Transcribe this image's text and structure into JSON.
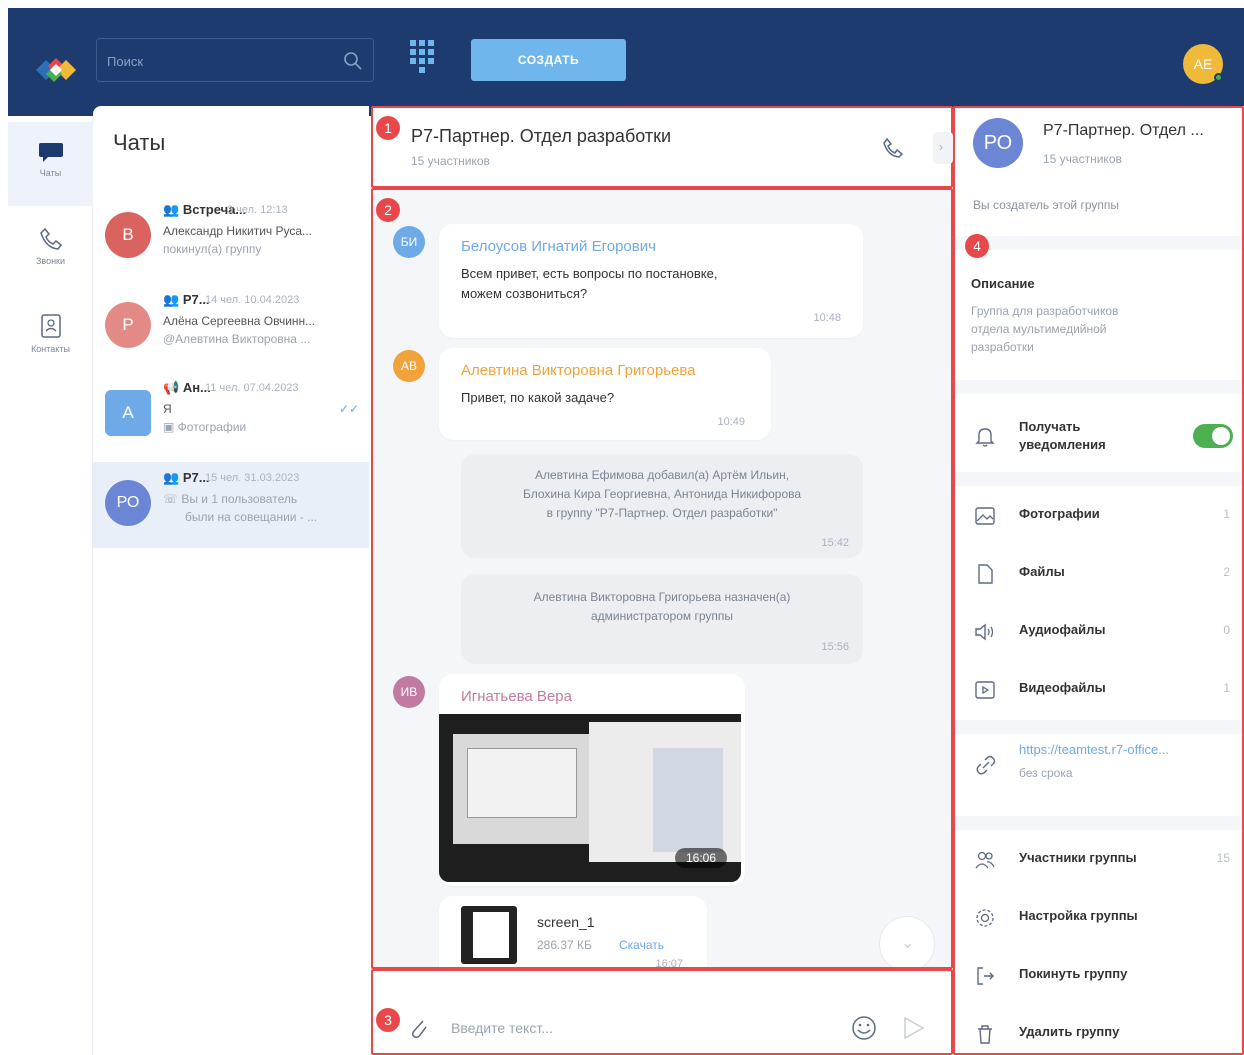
{
  "topbar": {
    "search_placeholder": "Поиск",
    "create_label": "СОЗДАТЬ",
    "user_initials": "АЕ"
  },
  "rail": {
    "items": [
      {
        "label": "Чаты"
      },
      {
        "label": "Звонки"
      },
      {
        "label": "Контакты"
      }
    ]
  },
  "chats": {
    "title": "Чаты",
    "items": [
      {
        "initial": "В",
        "name": "Встреча...",
        "meta": "3 чел.  12:13",
        "line1": "Александр Никитич Руса...",
        "line2": "покинул(а) группу",
        "color": "#d9645f"
      },
      {
        "initial": "Р",
        "name": "Р7...",
        "meta": "14 чел.  10.04.2023",
        "line1": "Алёна Сергеевна Овчинн...",
        "line2": "@Алевтина Викторовна ...",
        "color": "#e38a86"
      },
      {
        "initial": "А",
        "name": "Ан...",
        "meta": "11 чел.  07.04.2023",
        "line1": "Я",
        "line2": "Фотографии",
        "color": "#6ea9e8"
      },
      {
        "initial": "РО",
        "name": "Р7...",
        "meta": "15 чел.  31.03.2023",
        "line1": "Вы и 1 пользователь",
        "line2": "были на совещании - ...",
        "color": "#6c86d6"
      }
    ]
  },
  "chat": {
    "title": "Р7-Партнер. Отдел разработки",
    "participants": "15 участников",
    "messages": [
      {
        "initials": "БИ",
        "author": "Белоусов Игнатий Егорович",
        "text1": "Всем привет, есть вопросы по постановке,",
        "text2": "можем созвониться?",
        "time": "10:48"
      },
      {
        "initials": "АВ",
        "author": "Алевтина Викторовна Григорьева",
        "text1": "Привет, по какой задаче?",
        "time": "10:49"
      }
    ],
    "system": [
      {
        "line1": "Алевтина Ефимова добавил(а) Артём Ильин,",
        "line2": "Блохина Кира Георгиевна, Антонида Никифорова",
        "line3": "в группу \"Р7-Партнер. Отдел разработки\"",
        "time": "15:42"
      },
      {
        "line1": "Алевтина Викторовна Григорьева назначен(а)",
        "line2": "администратором группы",
        "time": "15:56"
      }
    ],
    "media_msg": {
      "initials": "ИВ",
      "author": "Игнатьева Вера",
      "video_time": "16:06",
      "file_name": "screen_1",
      "file_size": "286.37 КБ",
      "download": "Скачать",
      "file_time": "16:07"
    },
    "composer_placeholder": "Введите текст..."
  },
  "info": {
    "initials": "РО",
    "title": "Р7-Партнер. Отдел ...",
    "participants": "15 участников",
    "creator": "Вы создатель этой группы",
    "desc_title": "Описание",
    "desc1": "Группа для разработчиков",
    "desc2": "отдела мультимедийной",
    "desc3": "разработки",
    "notify_1": "Получать",
    "notify_2": "уведомления",
    "photos": "Фотографии",
    "photos_count": "1",
    "files": "Файлы",
    "files_count": "2",
    "audio": "Аудиофайлы",
    "audio_count": "0",
    "video": "Видеофайлы",
    "video_count": "1",
    "link": "https://teamtest.r7-office...",
    "link_sub": "без срока",
    "members": "Участники группы",
    "members_count": "15",
    "settings": "Настройка группы",
    "leave": "Покинуть группу",
    "delete": "Удалить группу"
  },
  "markers": [
    "1",
    "2",
    "3",
    "4"
  ],
  "colors": {
    "topbar": "#1d3b6e",
    "accent": "#6eb6ec",
    "marker": "#e8484a"
  }
}
